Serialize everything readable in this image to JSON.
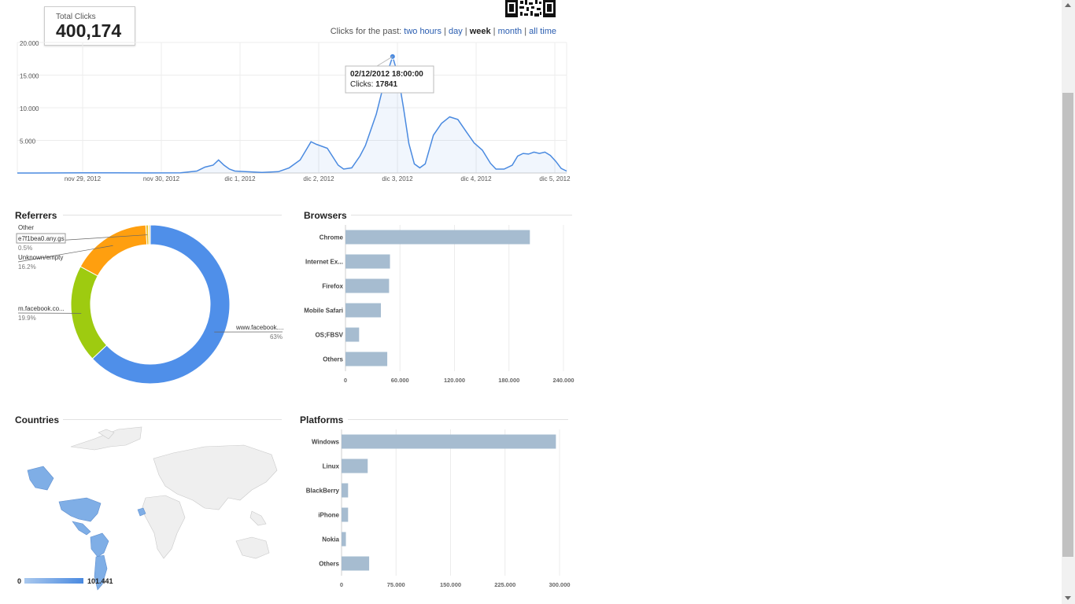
{
  "summary": {
    "total_label": "Total Clicks",
    "total_value": "400,174"
  },
  "range": {
    "prefix": "Clicks for the past:",
    "options": [
      "two hours",
      "day",
      "week",
      "month",
      "all time"
    ],
    "selected": "week"
  },
  "colors": {
    "line": "#4a8ae0",
    "bar": "#a6bcd0",
    "link": "#2a5db0",
    "map_fill": "#7faee6",
    "donut": [
      "#4f8fe9",
      "#9ecb10",
      "#ff9f0f",
      "#e8c12b",
      "#f5e1a0"
    ]
  },
  "icons": {
    "qr": "qr-code-icon"
  },
  "clicks_chart": {
    "chart_data": {
      "type": "area",
      "ylim": [
        0,
        20000
      ],
      "y_ticks": [
        "20.000",
        "15.000",
        "10.000",
        "5.000"
      ],
      "x_ticks": [
        "nov 29, 2012",
        "nov 30, 2012",
        "dic 1, 2012",
        "dic 2, 2012",
        "dic 3, 2012",
        "dic 4, 2012",
        "dic 5, 2012"
      ],
      "x_start": "28/11/2012 00:00",
      "x_step_hours": 2,
      "values": [
        0,
        0,
        0,
        0,
        0,
        0,
        0,
        0,
        0,
        0,
        0,
        0,
        0,
        0,
        0,
        0,
        0,
        0,
        0,
        0,
        0,
        0,
        0,
        0,
        0,
        0,
        0,
        0,
        0,
        0,
        0,
        0,
        0,
        0,
        0,
        0,
        0,
        0,
        0,
        0,
        0,
        0,
        0,
        0,
        0,
        0,
        0,
        0,
        0,
        0,
        0,
        0,
        0,
        0,
        0,
        0,
        0,
        0,
        0,
        0,
        0,
        0,
        0,
        0,
        0,
        0,
        0,
        0,
        0,
        0,
        0,
        0,
        0,
        0,
        0,
        0,
        0,
        0,
        0,
        0,
        0,
        0,
        0,
        0,
        0,
        0,
        0,
        0,
        0,
        0,
        0,
        0,
        0,
        0,
        0,
        0,
        0,
        0,
        0,
        0,
        0,
        0,
        0,
        0,
        0,
        0,
        0,
        0,
        0,
        0,
        0,
        0,
        0,
        0,
        0,
        0,
        0,
        0,
        0,
        0,
        0,
        0,
        0,
        0,
        0,
        0,
        0,
        0,
        0,
        0,
        0,
        0,
        0,
        0,
        0,
        0,
        0,
        0,
        0,
        0,
        0,
        0,
        0,
        0,
        0,
        0,
        0,
        0,
        0,
        0,
        0,
        0,
        0,
        0,
        0,
        0,
        0,
        0,
        0,
        0,
        0,
        0,
        0,
        0,
        0,
        0,
        0,
        0,
        0,
        0,
        0,
        0,
        0,
        0,
        0,
        0,
        0,
        0,
        0,
        0,
        0,
        0,
        0,
        0,
        0,
        0,
        0,
        0,
        0,
        0,
        0,
        0,
        0,
        0,
        0,
        0,
        0,
        0,
        0,
        0
      ],
      "points": [
        [
          0,
          0
        ],
        [
          6,
          0
        ],
        [
          24,
          40
        ],
        [
          36,
          20
        ],
        [
          48,
          10
        ],
        [
          60,
          20
        ],
        [
          66,
          300
        ],
        [
          69,
          900
        ],
        [
          72,
          1200
        ],
        [
          74,
          2000
        ],
        [
          76,
          1200
        ],
        [
          78,
          600
        ],
        [
          80,
          300
        ],
        [
          84,
          200
        ],
        [
          90,
          100
        ],
        [
          96,
          200
        ],
        [
          100,
          800
        ],
        [
          104,
          2000
        ],
        [
          108,
          4800
        ],
        [
          110,
          4400
        ],
        [
          114,
          3800
        ],
        [
          118,
          1200
        ],
        [
          120,
          600
        ],
        [
          123,
          800
        ],
        [
          126,
          2600
        ],
        [
          128,
          4200
        ],
        [
          132,
          9000
        ],
        [
          135,
          14000
        ],
        [
          138,
          17841
        ],
        [
          140,
          15000
        ],
        [
          142,
          10000
        ],
        [
          144,
          4500
        ],
        [
          146,
          1400
        ],
        [
          148,
          800
        ],
        [
          150,
          1400
        ],
        [
          153,
          5800
        ],
        [
          156,
          7600
        ],
        [
          159,
          8600
        ],
        [
          162,
          8200
        ],
        [
          165,
          6400
        ],
        [
          168,
          4600
        ],
        [
          171,
          3500
        ],
        [
          174,
          1500
        ],
        [
          176,
          600
        ],
        [
          179,
          600
        ],
        [
          182,
          1200
        ],
        [
          184,
          2600
        ],
        [
          186,
          3000
        ],
        [
          188,
          2900
        ],
        [
          190,
          3200
        ],
        [
          192,
          3000
        ],
        [
          194,
          3200
        ],
        [
          196,
          2700
        ],
        [
          198,
          1800
        ],
        [
          200,
          700
        ],
        [
          202,
          300
        ]
      ],
      "tooltip": {
        "date": "02/12/2012 18:00:00",
        "label": "Clicks:",
        "value": "17841"
      }
    }
  },
  "referrers": {
    "title": "Referrers",
    "chart_data": {
      "type": "pie",
      "slices": [
        {
          "name": "www.facebook....",
          "pct": "63%",
          "value": 63
        },
        {
          "name": "m.facebook.co...",
          "pct": "19.9%",
          "value": 19.9
        },
        {
          "name": "Unknown/empty",
          "pct": "16.2%",
          "value": 16.2
        },
        {
          "name": "e7f1bea0.any.gs",
          "pct": "0.5%",
          "value": 0.5
        },
        {
          "name": "Other",
          "pct": "",
          "value": 0.4
        }
      ]
    }
  },
  "browsers": {
    "title": "Browsers",
    "chart_data": {
      "type": "bar",
      "orientation": "horizontal",
      "categories": [
        "Chrome",
        "Internet Ex...",
        "Firefox",
        "Mobile Safari",
        "OS;FBSV",
        "Others"
      ],
      "values": [
        203000,
        49000,
        48000,
        39000,
        15000,
        46000
      ],
      "xlim": [
        0,
        240000
      ],
      "x_ticks": [
        "0",
        "60.000",
        "120.000",
        "180.000",
        "240.000"
      ]
    }
  },
  "countries": {
    "title": "Countries",
    "legend_min": "0",
    "legend_max": "101.441"
  },
  "platforms": {
    "title": "Platforms",
    "chart_data": {
      "type": "bar",
      "orientation": "horizontal",
      "categories": [
        "Windows",
        "Linux",
        "BlackBerry",
        "iPhone",
        "Nokia",
        "Others"
      ],
      "values": [
        295000,
        36000,
        9000,
        9000,
        6000,
        38000
      ],
      "xlim": [
        0,
        300000
      ],
      "x_ticks": [
        "0",
        "75.000",
        "150.000",
        "225.000",
        "300.000"
      ]
    }
  }
}
